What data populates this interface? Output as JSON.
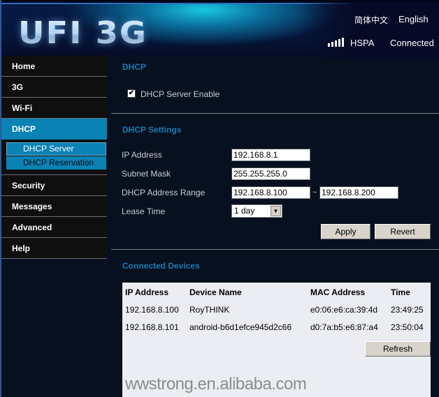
{
  "header": {
    "logo": "UFI 3G",
    "lang_chinese": "简体中文",
    "lang_english": "English",
    "network_type": "HSPA",
    "connection_status": "Connected",
    "signal_bars": 5
  },
  "sidebar": {
    "items": [
      {
        "label": "Home"
      },
      {
        "label": "3G"
      },
      {
        "label": "Wi-Fi"
      },
      {
        "label": "DHCP",
        "active": true
      },
      {
        "label": "Security"
      },
      {
        "label": "Messages"
      },
      {
        "label": "Advanced"
      },
      {
        "label": "Help"
      }
    ],
    "subitems": [
      {
        "label": "DHCP Server",
        "current": true
      },
      {
        "label": "DHCP Reservation"
      }
    ]
  },
  "dhcp": {
    "title": "DHCP",
    "enable_label": "DHCP Server Enable",
    "enable_checked": true,
    "check_mark": "✔"
  },
  "settings": {
    "title": "DHCP Settings",
    "ip_label": "IP Address",
    "ip_value": "192.168.8.1",
    "mask_label": "Subnet Mask",
    "mask_value": "255.255.255.0",
    "range_label": "DHCP Address Range",
    "range_start": "192.168.8.100",
    "range_sep": "~",
    "range_end": "192.168.8.200",
    "lease_label": "Lease Time",
    "lease_value": "1 day",
    "dropdown_arrow": "▼",
    "apply_label": "Apply",
    "revert_label": "Revert"
  },
  "devices": {
    "title": "Connected Devices",
    "columns": [
      "IP Address",
      "Device Name",
      "MAC Address",
      "Time"
    ],
    "rows": [
      [
        "192.168.8.100",
        "RoyTHINK",
        "e0:06:e6:ca:39:4d",
        "23:49:25"
      ],
      [
        "192.168.8.101",
        "android-b6d1efce945d2c66",
        "d0:7a:b5:e6:87:a4",
        "23:50:04"
      ]
    ],
    "refresh_label": "Refresh"
  },
  "watermark": "wwstrong.en.alibaba.com"
}
